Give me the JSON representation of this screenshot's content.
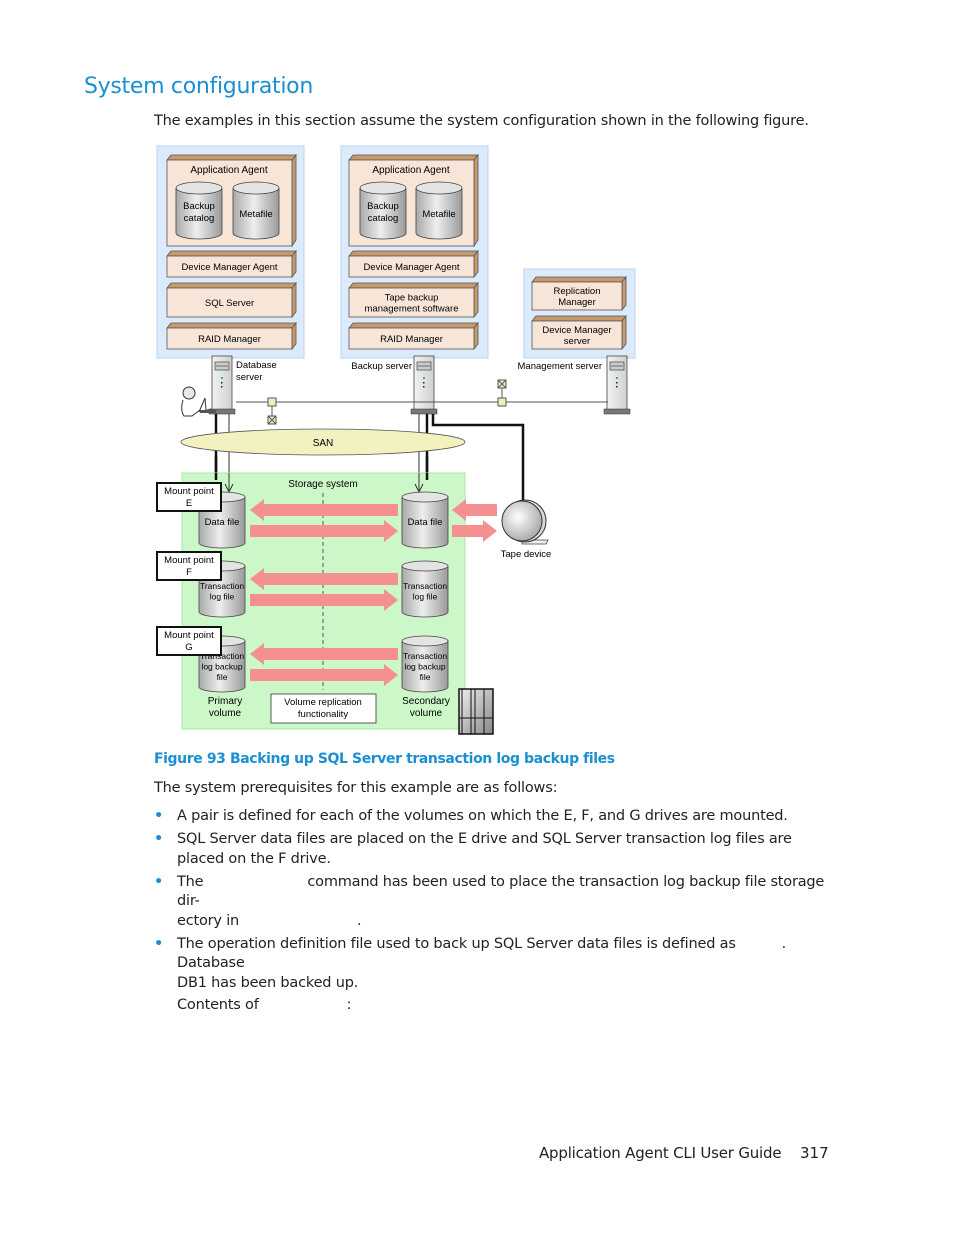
{
  "heading": "System configuration",
  "intro": "The examples in this section assume the system configuration shown in the following figure.",
  "figure": {
    "caption": "Figure 93 Backing up SQL Server transaction log backup files",
    "database_server": {
      "label_line1": "Database",
      "label_line2": "server",
      "app_agent": "Application Agent",
      "backup_catalog_line1": "Backup",
      "backup_catalog_line2": "catalog",
      "metafile": "Metafile",
      "components": [
        "Device Manager Agent",
        "SQL Server",
        "RAID Manager"
      ]
    },
    "backup_server": {
      "label": "Backup server",
      "app_agent": "Application Agent",
      "backup_catalog_line1": "Backup",
      "backup_catalog_line2": "catalog",
      "metafile": "Metafile",
      "device_manager_agent": "Device Manager Agent",
      "tape_sw_line1": "Tape backup",
      "tape_sw_line2": "management software",
      "raid_manager": "RAID Manager"
    },
    "management_server": {
      "label": "Management server",
      "replication_line1": "Replication",
      "replication_line2": "Manager",
      "dm_server_line1": "Device Manager",
      "dm_server_line2": "server"
    },
    "san": "SAN",
    "storage_system": "Storage system",
    "tape_device": "Tape device",
    "mount_points": [
      {
        "line1": "Mount point",
        "line2": "E"
      },
      {
        "line1": "Mount point",
        "line2": "F"
      },
      {
        "line1": "Mount point",
        "line2": "G"
      }
    ],
    "primary_volumes": [
      {
        "lines": [
          "Data file"
        ]
      },
      {
        "lines": [
          "Transaction",
          "log file"
        ]
      },
      {
        "lines": [
          "Transaction",
          "log backup",
          "file"
        ]
      }
    ],
    "secondary_volumes": [
      {
        "lines": [
          "Data file"
        ]
      },
      {
        "lines": [
          "Transaction",
          "log file"
        ]
      },
      {
        "lines": [
          "Transaction",
          "log backup",
          "file"
        ]
      }
    ],
    "primary_label_line1": "Primary",
    "primary_label_line2": "volume",
    "secondary_label_line1": "Secondary",
    "secondary_label_line2": "volume",
    "replication_line1": "Volume replication",
    "replication_line2": "functionality",
    "colors": {
      "server_panel": "#dcebfb",
      "component_box": "#f7e6d8",
      "component_side": "#c79a6c",
      "storage_bg": "#ccf7c8",
      "arrow": "#f59090",
      "san": "#f3f1c0"
    }
  },
  "prereq_intro": "The system prerequisites for this example are as follows:",
  "bullets": [
    {
      "text": "A pair is defined for each of the volumes on which the E, F, and G drives are mounted."
    },
    {
      "text": "SQL Server data files are placed on the E drive and SQL Server transaction log files are placed on the F drive."
    },
    {
      "part1": "The",
      "part2": "command has been used to place the transaction log backup file storage dir-",
      "part3": "ectory in",
      "part4": "."
    },
    {
      "part1": "The operation definition file used to back up SQL Server data files is defined as",
      "part2": ". Database",
      "part3": "DB1 has been backed up."
    }
  ],
  "contents_of": {
    "part1": "Contents of",
    "part2": ":"
  },
  "footer": {
    "title": "Application Agent CLI User Guide",
    "page": "317"
  }
}
